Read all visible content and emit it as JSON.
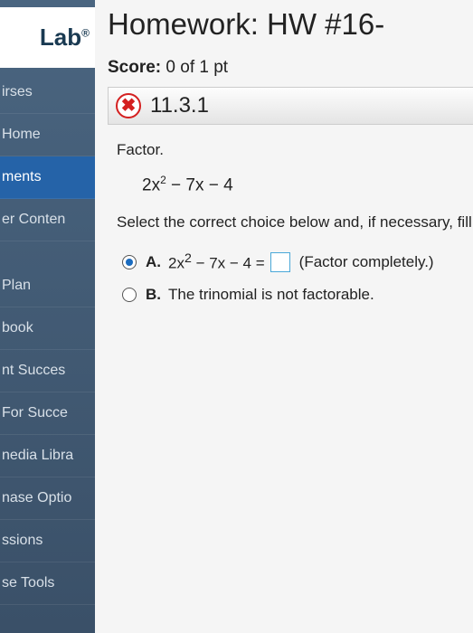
{
  "sidebar": {
    "logo": "Lab",
    "logo_sup": "®",
    "items": [
      {
        "label": "irses",
        "active": false
      },
      {
        "label": "Home",
        "active": false
      },
      {
        "label": "ments",
        "active": true
      },
      {
        "label": "er Conten",
        "active": false
      },
      {
        "label": "Plan",
        "active": false
      },
      {
        "label": "book",
        "active": false
      },
      {
        "label": "nt Succes",
        "active": false
      },
      {
        "label": "For Succe",
        "active": false
      },
      {
        "label": "nedia Libra",
        "active": false
      },
      {
        "label": "nase Optio",
        "active": false
      },
      {
        "label": "ssions",
        "active": false
      },
      {
        "label": "se Tools",
        "active": false
      }
    ]
  },
  "header": {
    "title": "Homework: HW #16-",
    "score_label": "Score:",
    "score_value": "0 of 1 pt"
  },
  "question": {
    "number": "11.3.1",
    "instruction": "Factor.",
    "expression_prefix": "2x",
    "expression_exp": "2",
    "expression_suffix": " − 7x − 4",
    "prompt": "Select the correct choice below and, if necessary, fill ",
    "choices": {
      "a": {
        "letter": "A.",
        "expr_prefix": "2x",
        "expr_exp": "2",
        "expr_suffix": " − 7x − 4 =",
        "hint": "(Factor completely.)"
      },
      "b": {
        "letter": "B.",
        "text": "The trinomial is not factorable."
      }
    }
  }
}
